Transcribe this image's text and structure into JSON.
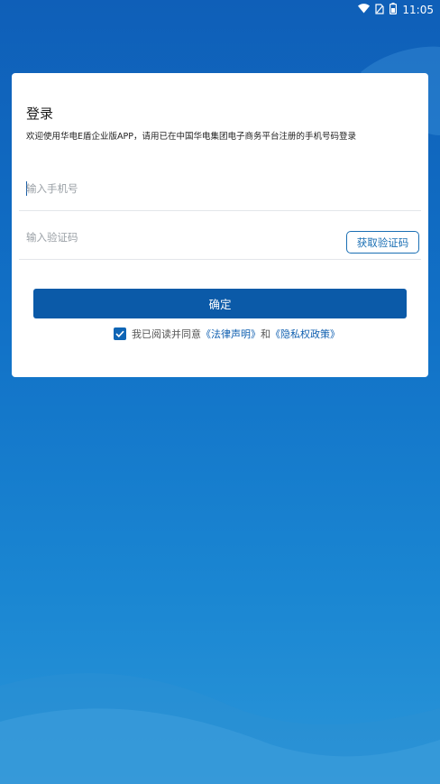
{
  "status_bar": {
    "time": "11:05",
    "icons": [
      "wifi-icon",
      "no-sim-icon",
      "battery-icon"
    ]
  },
  "login": {
    "title": "登录",
    "subtitle": "欢迎使用华电E盾企业版APP，请用已在中国华电集团电子商务平台注册的手机号码登录",
    "phone_placeholder": "输入手机号",
    "phone_value": "",
    "code_placeholder": "输入验证码",
    "code_value": "",
    "get_code_label": "获取验证码",
    "confirm_label": "确定",
    "agreement": {
      "checked": true,
      "prefix": "我已阅读并同意",
      "legal_link": "《法律声明》",
      "and": "和",
      "privacy_link": "《隐私权政策》"
    }
  },
  "colors": {
    "primary": "#0b5aa8",
    "background_top": "#0f5fb8",
    "background_bottom": "#2a95d8",
    "link": "#0f5fb0"
  }
}
